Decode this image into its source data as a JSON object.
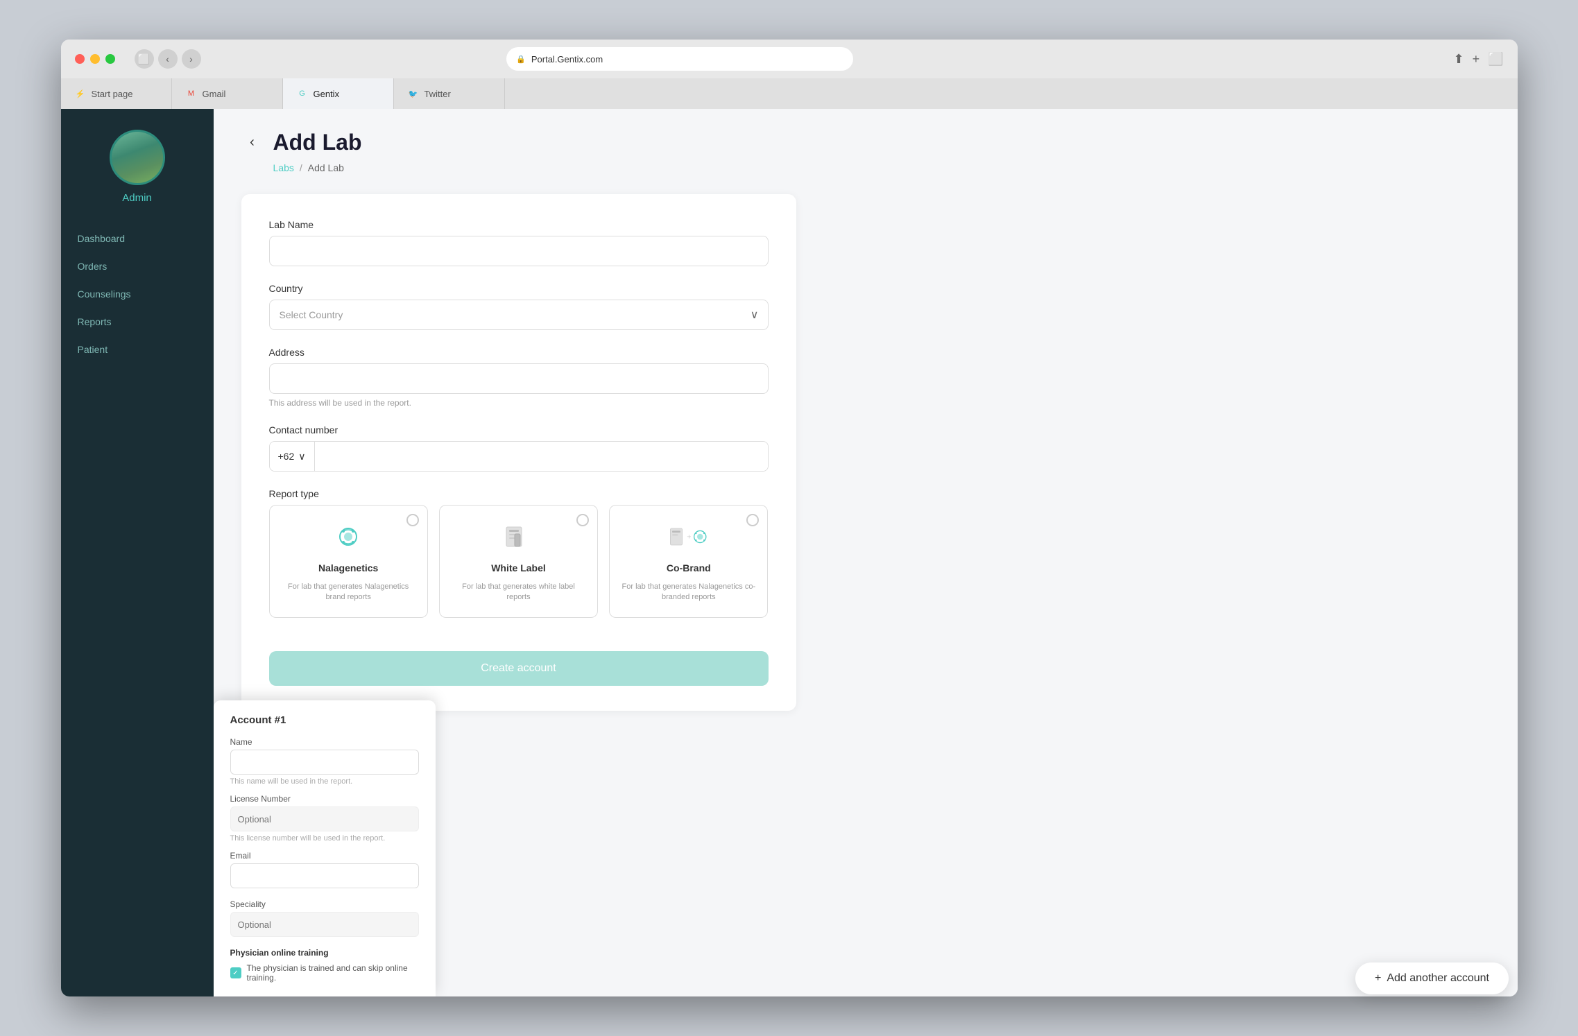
{
  "browser": {
    "url": "Portal.Gentix.com",
    "tabs": [
      {
        "id": "start",
        "label": "Start page",
        "favicon_char": "⚡",
        "active": false
      },
      {
        "id": "gmail",
        "label": "Gmail",
        "favicon_char": "M",
        "favicon_color": "#EA4335",
        "active": false
      },
      {
        "id": "gentix",
        "label": "Gentix",
        "favicon_char": "G",
        "favicon_color": "#4ecdc4",
        "active": true
      },
      {
        "id": "twitter",
        "label": "Twitter",
        "favicon_char": "🐦",
        "active": false
      }
    ]
  },
  "sidebar": {
    "user_name": "Admin",
    "nav_items": [
      {
        "id": "dashboard",
        "label": "Dashboard"
      },
      {
        "id": "orders",
        "label": "Orders"
      },
      {
        "id": "counselings",
        "label": "Counselings"
      },
      {
        "id": "reports",
        "label": "Reports"
      },
      {
        "id": "patient",
        "label": "Patient"
      }
    ]
  },
  "page": {
    "title": "Add Lab",
    "breadcrumb_parent": "Labs",
    "breadcrumb_current": "Add Lab",
    "back_icon": "‹"
  },
  "form": {
    "lab_name_label": "Lab Name",
    "lab_name_placeholder": "",
    "country_label": "Country",
    "country_placeholder": "Select Country",
    "address_label": "Address",
    "address_placeholder": "",
    "address_hint": "This address will be used in the report.",
    "contact_label": "Contact number",
    "phone_code": "+62",
    "report_type_label": "Report type",
    "report_types": [
      {
        "id": "nalagenetics",
        "name": "Nalagenetics",
        "desc": "For lab that generates Nalagenetics brand reports"
      },
      {
        "id": "whitelabel",
        "name": "White Label",
        "desc": "For lab that generates white label reports"
      },
      {
        "id": "cobrand",
        "name": "Co-Brand",
        "desc": "For lab that generates Nalagenetics co-branded reports"
      }
    ],
    "create_btn_label": "Create account"
  },
  "account_panel": {
    "title": "Account #1",
    "name_label": "Name",
    "name_hint": "This name will be used in the report.",
    "license_label": "License Number",
    "license_placeholder": "Optional",
    "license_hint": "This license number will be used in the report.",
    "email_label": "Email",
    "email_placeholder": "",
    "speciality_label": "Speciality",
    "speciality_placeholder": "Optional",
    "training_label": "Physician online training",
    "training_checkbox_label": "The physician is trained and can skip online training."
  },
  "footer": {
    "add_account_icon": "+",
    "add_account_label": "Add another account"
  }
}
